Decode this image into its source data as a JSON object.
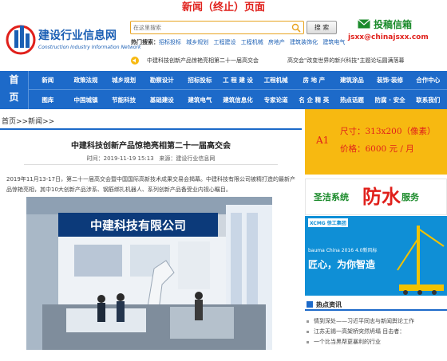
{
  "page_caption": "新闻（终止）页面",
  "header": {
    "logo_cn": "建设行业信息网",
    "logo_en": "Construction Industry Information Network",
    "search_placeholder": "在这里搜索",
    "search_button": "搜 索",
    "hot_search_label": "热门搜索：",
    "hot_search_items": [
      "招标投标",
      "城乡规划",
      "工程建设",
      "工程机械",
      "房地产",
      "建筑装饰化",
      "建筑电气"
    ],
    "submit_title": "投稿信箱",
    "submit_email": "jsxx@chinajsxx.com",
    "ticker": [
      "中建科技创新产品惊艳亮相第二十一届高交会",
      "高交会\"改变世界的新兴科技\"主题论坛圆满落幕"
    ]
  },
  "nav": {
    "home_top": "首",
    "home_bottom": "页",
    "row1": [
      "新闻",
      "政策法规",
      "城乡规划",
      "勘察设计",
      "招标投标",
      "工 程 建 设",
      "工程机械",
      "房 地 产",
      "建筑涂品",
      "装饰·装修",
      "合作中心"
    ],
    "row2": [
      "图库",
      "中国城镇",
      "节能科技",
      "基础建设",
      "建筑电气",
      "建筑信息化",
      "专家论道",
      "名 企 精 英",
      "热点话题",
      "防腐 · 安全",
      "联系我们"
    ]
  },
  "breadcrumb": "首页>>新闻>>",
  "article": {
    "title": "中建科技创新产品惊艳亮相第二十一届高交会",
    "time_label": "时间：",
    "time": "2019-11-19 15:13",
    "source_label": "来源：",
    "source": "建设行业信息网",
    "body": "2019年11月13-17日，第二十一届高交会暨中国国际高新技术成果交易会揭幕。中建科技有限公司被精打造的最新产品惊艳亮相，其中10大创新产品涉系、钢筋绑扎机器人、系列创新产品备受业内视心瞩目。",
    "photo_sign": "中建科技有限公司"
  },
  "sidebar": {
    "ad_a1": {
      "label": "A1",
      "size": "尺寸：313x200（像素）",
      "price": "价格：6000 元 / 月"
    },
    "ad_water": {
      "left": "圣洁系统",
      "big": "防水",
      "right": "服务"
    },
    "ad_xcmg": {
      "logo": "XCMG 徐工集团",
      "line1": "bauma China 2016 4.0新风标",
      "line2": "匠心，为你智造"
    },
    "hot_news_title": "热点资讯",
    "hot_news": [
      "情到深处——习近平同志与新闻舆论工作",
      "江苏无锡一高架桥突然坍塌  目击者：",
      "一个比当黑帮更暴利的行业"
    ]
  },
  "colors": {
    "nav_blue": "#1d6ac9",
    "ad_yellow": "#f7b911",
    "caption_red": "#e0201b",
    "xcmg_blue": "#0f8fd6"
  }
}
